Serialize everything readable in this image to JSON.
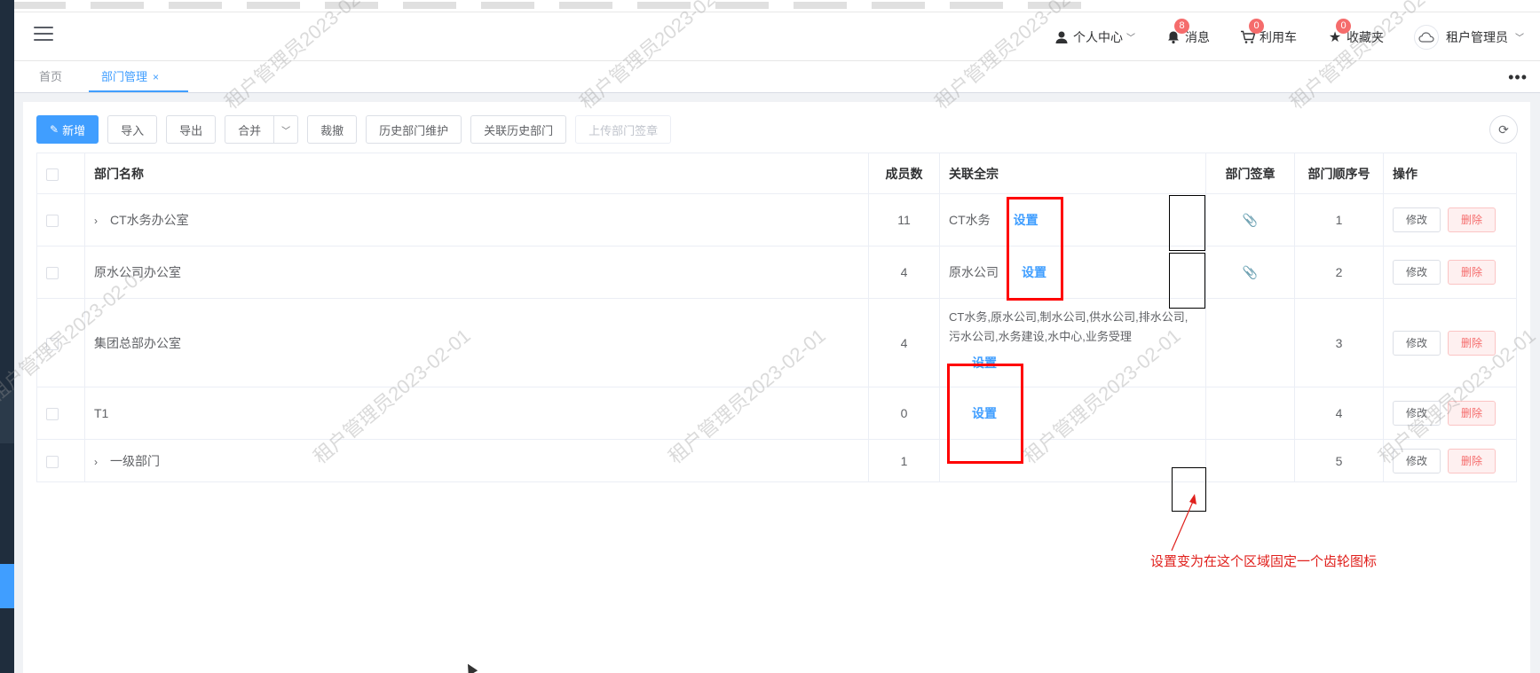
{
  "navbar": {
    "user_center": "个人中心",
    "messages": {
      "label": "消息",
      "count": "8"
    },
    "cart": {
      "label": "利用车",
      "count": "0"
    },
    "favorites": {
      "label": "收藏夹",
      "count": "0"
    },
    "account": "租户管理员"
  },
  "tabs": [
    {
      "label": "首页"
    },
    {
      "label": "部门管理"
    }
  ],
  "toolbar": {
    "add": "新增",
    "import": "导入",
    "export": "导出",
    "merge": "合并",
    "dissolve": "裁撤",
    "history_maintain": "历史部门维护",
    "link_history": "关联历史部门",
    "upload_seal": "上传部门签章"
  },
  "table": {
    "headers": {
      "name": "部门名称",
      "members": "成员数",
      "related": "关联全宗",
      "seal": "部门签章",
      "order": "部门顺序号",
      "ops": "操作"
    },
    "edit_label": "修改",
    "delete_label": "删除",
    "set_label": "设置",
    "rows": [
      {
        "name": "CT水务办公室",
        "members": "11",
        "related": "CT水务",
        "order": "1"
      },
      {
        "name": "原水公司办公室",
        "members": "4",
        "related": "原水公司",
        "order": "2"
      },
      {
        "name": "集团总部办公室",
        "members": "4",
        "related": "CT水务,原水公司,制水公司,供水公司,排水公司,污水公司,水务建设,水中心,业务受理",
        "order": "3"
      },
      {
        "name": "T1",
        "members": "0",
        "related": "",
        "order": "4"
      },
      {
        "name": "一级部门",
        "members": "1",
        "related": "",
        "order": "5"
      }
    ]
  },
  "annotation": "设置变为在这个区域固定一个齿轮图标",
  "watermark": "租户管理员2023-02-01",
  "colors": {
    "primary": "#409eff",
    "danger": "#f56c6c",
    "annotation_red": "#ff0000"
  }
}
